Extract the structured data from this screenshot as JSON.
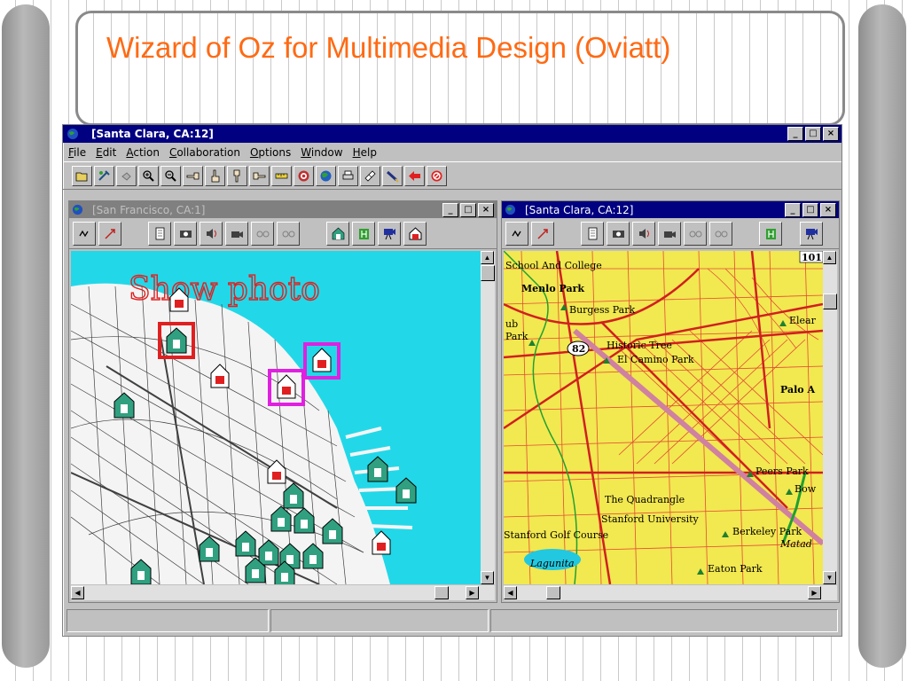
{
  "slide": {
    "title": "Wizard of Oz for Multimedia Design (Oviatt)",
    "accent_color": "#ff6a13"
  },
  "app": {
    "window_title": "[Santa Clara, CA:12]",
    "window_buttons": [
      "_",
      "□",
      "×"
    ],
    "menu": [
      "File",
      "Edit",
      "Action",
      "Collaboration",
      "Options",
      "Window",
      "Help"
    ],
    "toolbar_icons": [
      "open-folder-icon",
      "tools-icon",
      "hand-pointer-icon",
      "zoom-in-icon",
      "zoom-out-icon",
      "point-left-icon",
      "hand-up-icon",
      "point-down-icon",
      "point-right-icon",
      "ruler-icon",
      "target-icon",
      "globe-icon",
      "printer-icon",
      "notepad-icon",
      "pen-icon",
      "back-arrow-icon",
      "stop-icon"
    ]
  },
  "left_window": {
    "title": "[San Francisco, CA:1]",
    "handwriting": "Show photo",
    "tool_icons": [
      "scribble-icon",
      "arrow-pen-icon",
      "document-icon",
      "camera-icon",
      "sound-icon",
      "video-camera-icon",
      "glasses-icon",
      "glasses-icon",
      "house-photo-icon",
      "hotel-icon",
      "video-house-icon",
      "red-house-icon"
    ]
  },
  "right_window": {
    "title": "[Santa Clara, CA:12]",
    "map_labels": [
      "School And College",
      "Menlo Park",
      "Burgess Park",
      "ub",
      "Park",
      "82",
      "Historic Tree",
      "El Camino Park",
      "Elear",
      "Palo A",
      "Peers Park",
      "Bow",
      "The Quadrangle",
      "Stanford University",
      "Berkeley Park",
      "Matad",
      "Stanford Golf Course",
      "Lagunita",
      "Eaton Park",
      "101"
    ],
    "tool_icons": [
      "scribble-icon",
      "arrow-pen-icon",
      "document-icon",
      "camera-icon",
      "sound-icon",
      "video-camera-icon",
      "glasses-icon",
      "glasses-icon",
      "hotel-icon",
      "video-house-icon"
    ]
  }
}
